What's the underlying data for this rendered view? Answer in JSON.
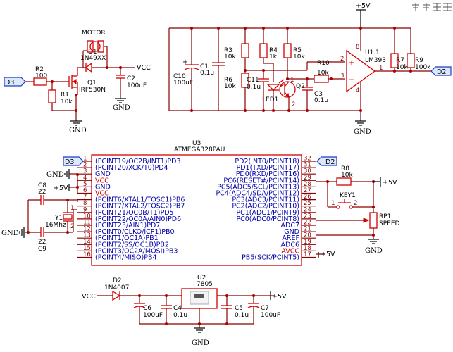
{
  "toolbar": {
    "icons": [
      "pin-icon",
      "pin-icon",
      "grid-icon",
      "grid-icon"
    ]
  },
  "labels": {
    "vcc_top": "+5V",
    "motor_vcc": "VCC",
    "gnd": "GND",
    "d3": "D3",
    "d2": "D2",
    "vcc_reg": "VCC",
    "plus5v": "+5V"
  },
  "components": {
    "motor": {
      "title": "MOTOR",
      "ref": "D1",
      "value": "1N49XX"
    },
    "r2": {
      "ref": "R2",
      "value": "100"
    },
    "r1": {
      "ref": "R1",
      "value": "10k"
    },
    "q1": {
      "ref": "Q1",
      "value": "IRF530N"
    },
    "c2": {
      "ref": "C2",
      "value": "100uF"
    },
    "c10": {
      "ref": "C10",
      "value": "100uF"
    },
    "c1": {
      "ref": "C1",
      "value": "0.1u"
    },
    "r3": {
      "ref": "R3",
      "value": "10k"
    },
    "r6": {
      "ref": "R6",
      "value": "10k"
    },
    "c11": {
      "ref": "C11",
      "value": "0.1u"
    },
    "r4": {
      "ref": "R4",
      "value": "1k"
    },
    "r5": {
      "ref": "R5",
      "value": "10k"
    },
    "led1": {
      "ref": "LED1"
    },
    "q2": {
      "ref": "Q2"
    },
    "r10": {
      "ref": "R10",
      "value": "10k"
    },
    "c3": {
      "ref": "C3",
      "value": "0.1u"
    },
    "u1": {
      "ref": "U1.1",
      "value": "LM393"
    },
    "r7": {
      "ref": "R7",
      "value": "10k"
    },
    "r9": {
      "ref": "R9",
      "value": "100k"
    },
    "u3": {
      "ref": "U3",
      "value": "ATMEGA328PAU"
    },
    "c8": {
      "ref": "C8",
      "value": "22"
    },
    "c9": {
      "ref": "C9",
      "value": "22"
    },
    "y1": {
      "ref": "Y1",
      "value": "16Mhz"
    },
    "r8": {
      "ref": "R8",
      "value": "10k"
    },
    "key1": {
      "ref": "KEY1"
    },
    "rp1": {
      "ref": "RP1",
      "value": "SPEED"
    },
    "d2diode": {
      "ref": "D2",
      "value": "1N4007"
    },
    "u2": {
      "ref": "U2",
      "value": "7805"
    },
    "c6": {
      "ref": "C6",
      "value": "100uF"
    },
    "c4": {
      "ref": "C4",
      "value": "0.1u"
    },
    "c5": {
      "ref": "C5",
      "value": "0.1u"
    },
    "c7": {
      "ref": "C7",
      "value": "100uF"
    }
  },
  "mcu_left_pins": [
    {
      "num": "1",
      "name": "(PCINT19/OC2B/INT1)PD3"
    },
    {
      "num": "2",
      "name": "(PCINT20/XCK/T0)PD4"
    },
    {
      "num": "3",
      "name": "GND"
    },
    {
      "num": "4",
      "name": "VCC"
    },
    {
      "num": "5",
      "name": "GND"
    },
    {
      "num": "6",
      "name": "VCC"
    },
    {
      "num": "7",
      "name": "(PCINT6/XTAL1/TOSC1)PB6"
    },
    {
      "num": "8",
      "name": "(PCINT7/XTAL2/TOSC2)PB7"
    },
    {
      "num": "9",
      "name": "(PCINT21/OC0B/T1)PD5"
    },
    {
      "num": "10",
      "name": "(PCINT22/OC0A/AIN0)PD6"
    },
    {
      "num": "11",
      "name": "(PCINT23/AIN1)PD7"
    },
    {
      "num": "12",
      "name": "(PCINT0/CLKO/ICP1)PB0"
    },
    {
      "num": "13",
      "name": "(PCINT1/OC1A)PB1"
    },
    {
      "num": "14",
      "name": "(PCINT2/SS/OC1B)PB2"
    },
    {
      "num": "15",
      "name": "(PCINT3/OC2A/MOSI)PB3"
    },
    {
      "num": "16",
      "name": "(PCINT4/MISO)PB4"
    }
  ],
  "mcu_right_pins": [
    {
      "num": "32",
      "name": "PD2(INT0/PCINT18)"
    },
    {
      "num": "31",
      "name": "PD1(TXD/PCINT17)"
    },
    {
      "num": "30",
      "name": "PD0(RXD/PCINT16)"
    },
    {
      "num": "29",
      "name": "PC6(RESET#/PCINT14)"
    },
    {
      "num": "28",
      "name": "PC5(ADC5/SCL/PCINT13)"
    },
    {
      "num": "27",
      "name": "PC4(ADC4/SDA/PCINT12)"
    },
    {
      "num": "26",
      "name": "PC3(ADC3/PCINT11)"
    },
    {
      "num": "25",
      "name": "PC2(ADC2/PCINT10)"
    },
    {
      "num": "24",
      "name": "PC1(ADC1/PCINT9)"
    },
    {
      "num": "23",
      "name": "PC0(ADC0/PCINT8)"
    },
    {
      "num": "22",
      "name": "ADC7"
    },
    {
      "num": "21",
      "name": "GND"
    },
    {
      "num": "20",
      "name": "AREF"
    },
    {
      "num": "19",
      "name": "ADC6"
    },
    {
      "num": "18",
      "name": "AVCC"
    },
    {
      "num": "17",
      "name": "PB5(SCK/PCINT5)"
    }
  ],
  "opamp_pins": {
    "p8": "8",
    "p2": "2",
    "p3": "3",
    "p1": "1",
    "p4": "4"
  },
  "key_pins": {
    "p1": "1",
    "p2": "2"
  },
  "misc_pins": {
    "q2_1": "1",
    "q2_2": "2",
    "y1_1": "1",
    "y1_2": "2"
  }
}
